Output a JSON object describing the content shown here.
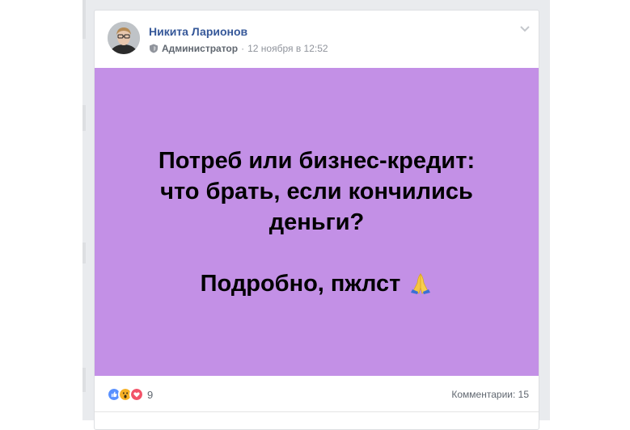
{
  "post": {
    "author": "Никита Ларионов",
    "role": "Администратор",
    "separator": "·",
    "timestamp": "12 ноября в 12:52",
    "lines": [
      "Потреб или бизнес-кредит:",
      "что брать, если кончились",
      "деньги?"
    ],
    "tail": "Подробно, пжлст",
    "emoji": "folded-hands-icon",
    "background_color": "#c390e6"
  },
  "footer": {
    "reaction_icons": [
      "like-icon",
      "wow-icon",
      "love-icon"
    ],
    "reactions_count": "9",
    "comments": "Комментарии: 15"
  }
}
